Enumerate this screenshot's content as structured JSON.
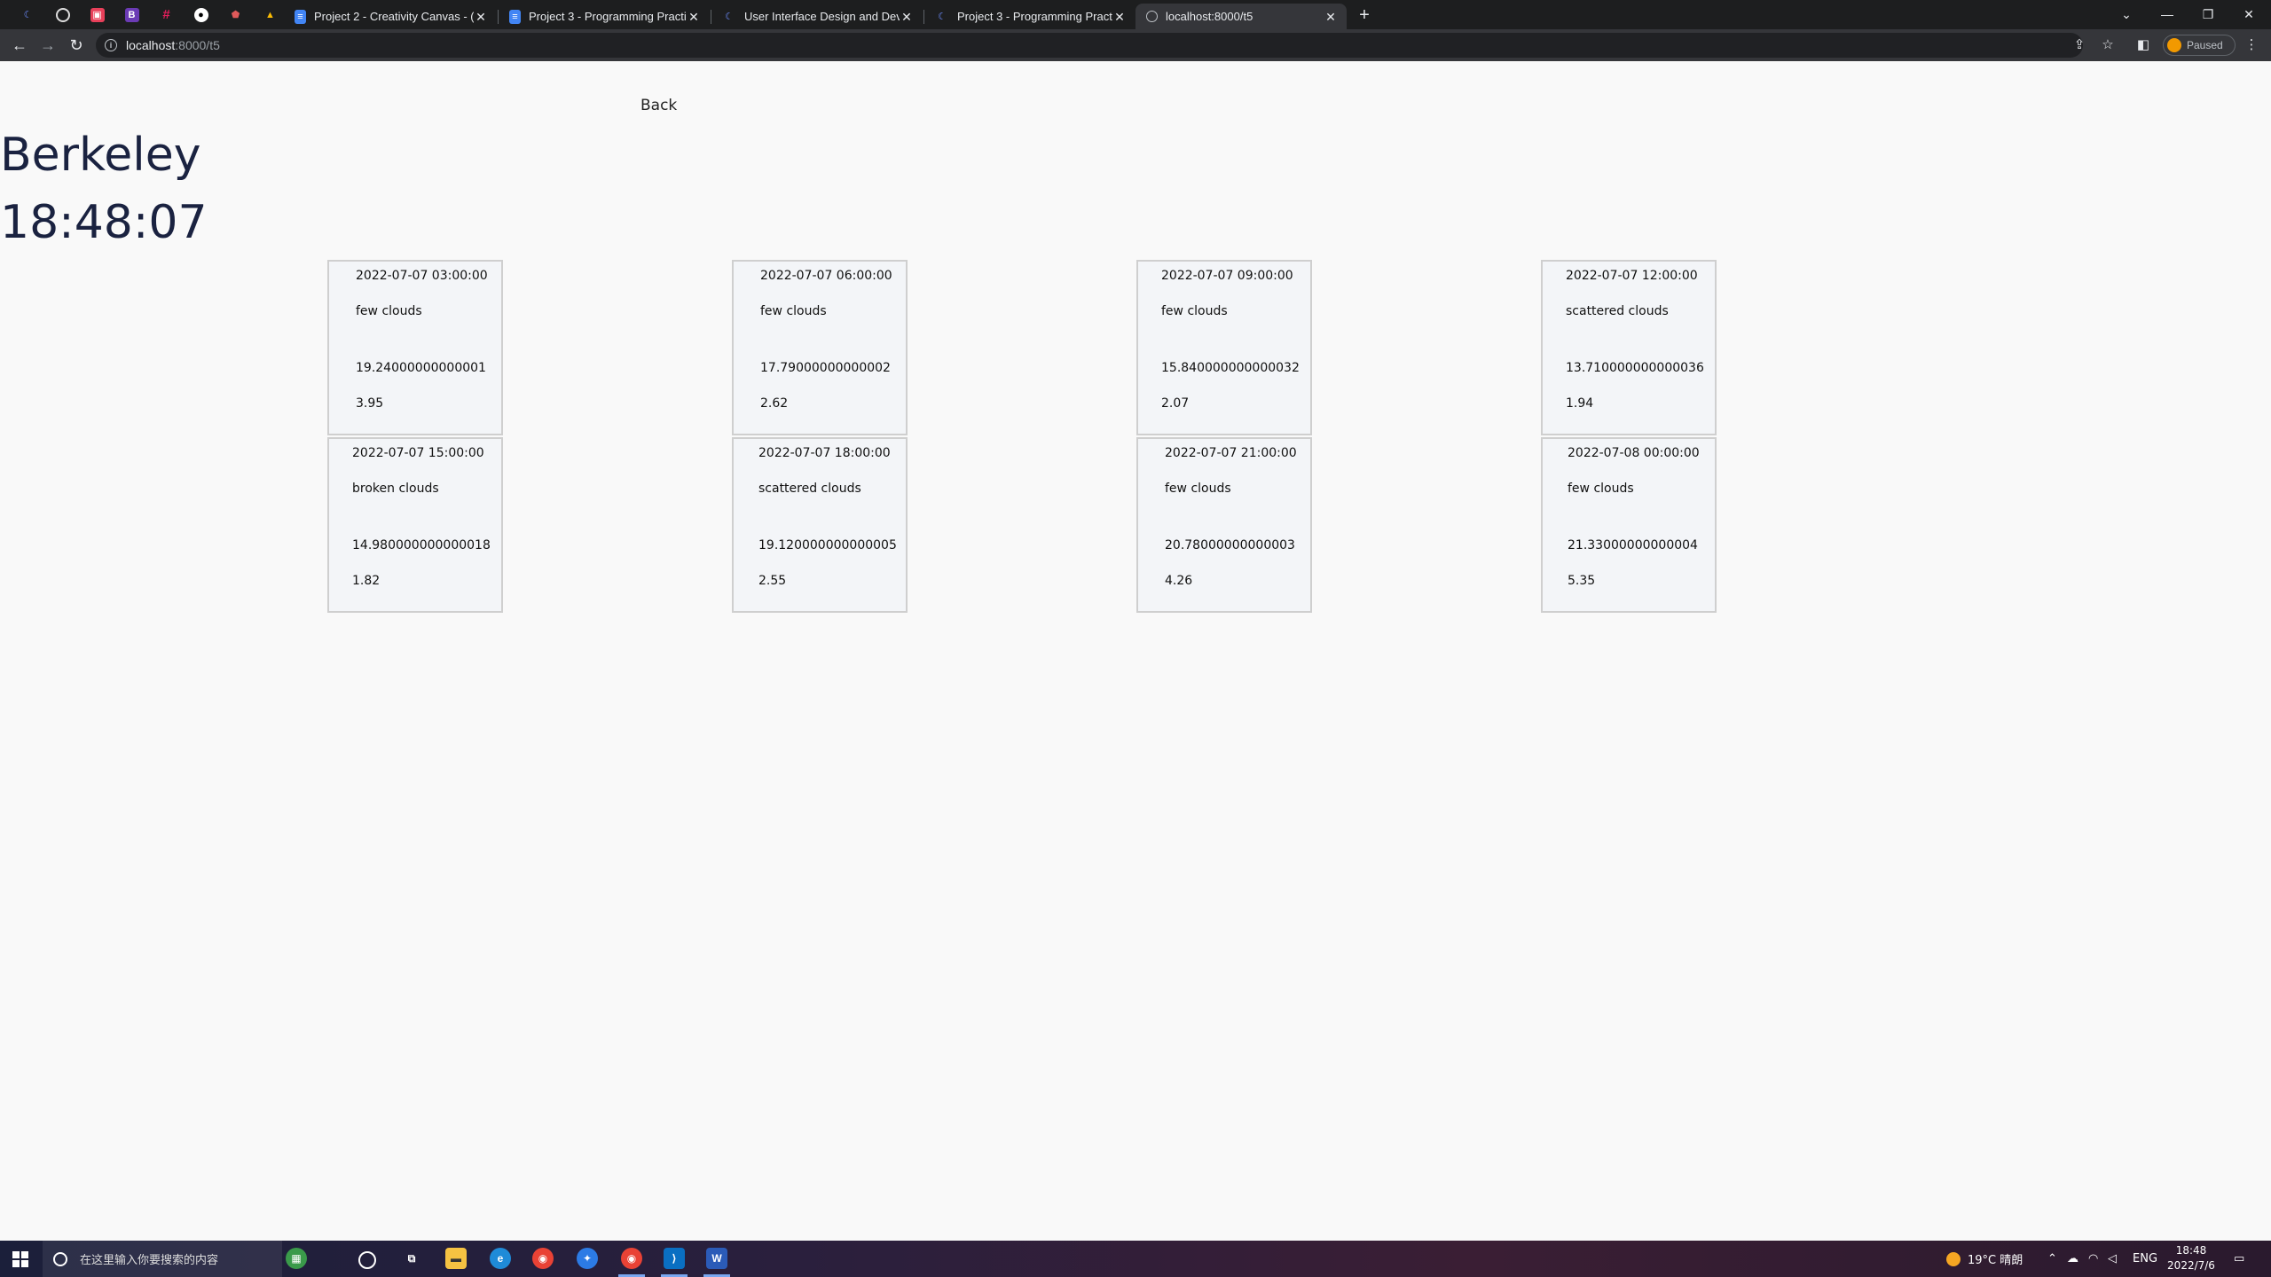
{
  "browser": {
    "tabs": [
      {
        "title": "Project 2 - Creativity Canvas - (",
        "active": false
      },
      {
        "title": "Project 3 - Programming Practi",
        "active": false
      },
      {
        "title": "User Interface Design and Dev",
        "active": false
      },
      {
        "title": "Project 3 - Programming Practi",
        "active": false
      },
      {
        "title": "localhost:8000/t5",
        "active": true
      }
    ],
    "url_host": "localhost",
    "url_rest": ":8000/t5",
    "profile_status": "Paused"
  },
  "page": {
    "back_label": "Back",
    "city": "Berkeley",
    "time": "18:48:07",
    "forecasts": [
      {
        "datetime": "2022-07-07 03:00:00",
        "description": "few clouds",
        "temp": "19.24000000000001",
        "wind": "3.95"
      },
      {
        "datetime": "2022-07-07 06:00:00",
        "description": "few clouds",
        "temp": "17.79000000000002",
        "wind": "2.62"
      },
      {
        "datetime": "2022-07-07 09:00:00",
        "description": "few clouds",
        "temp": "15.840000000000032",
        "wind": "2.07"
      },
      {
        "datetime": "2022-07-07 12:00:00",
        "description": "scattered clouds",
        "temp": "13.710000000000036",
        "wind": "1.94"
      },
      {
        "datetime": "2022-07-07 15:00:00",
        "description": "broken clouds",
        "temp": "14.980000000000018",
        "wind": "1.82"
      },
      {
        "datetime": "2022-07-07 18:00:00",
        "description": "scattered clouds",
        "temp": "19.120000000000005",
        "wind": "2.55"
      },
      {
        "datetime": "2022-07-07 21:00:00",
        "description": "few clouds",
        "temp": "20.78000000000003",
        "wind": "4.26"
      },
      {
        "datetime": "2022-07-08 00:00:00",
        "description": "few clouds",
        "temp": "21.33000000000004",
        "wind": "5.35"
      }
    ]
  },
  "taskbar": {
    "search_placeholder": "在这里输入你要搜索的内容",
    "weather": "19°C 晴朗",
    "language": "ENG",
    "time": "18:48",
    "date": "2022/7/6"
  }
}
